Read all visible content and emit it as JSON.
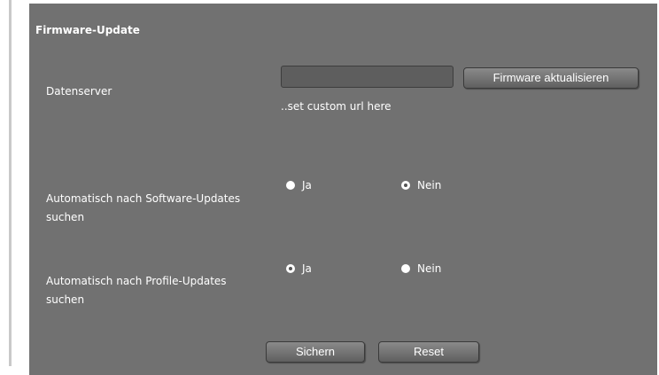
{
  "section": {
    "title": "Firmware-Update"
  },
  "dataserver": {
    "label": "Datenserver",
    "input_value": "",
    "hint": "..set custom url here",
    "update_button": "Firmware aktualisieren"
  },
  "software_updates": {
    "label_line1": "Automatisch nach Software-Updates",
    "label_line2": "suchen",
    "options": [
      {
        "label": "Ja",
        "checked": false
      },
      {
        "label": "Nein",
        "checked": true
      }
    ]
  },
  "profile_updates": {
    "label_line1": "Automatisch nach Profile-Updates",
    "label_line2": "suchen",
    "options": [
      {
        "label": "Ja",
        "checked": true
      },
      {
        "label": "Nein",
        "checked": false
      }
    ]
  },
  "actions": {
    "save": "Sichern",
    "reset": "Reset"
  }
}
